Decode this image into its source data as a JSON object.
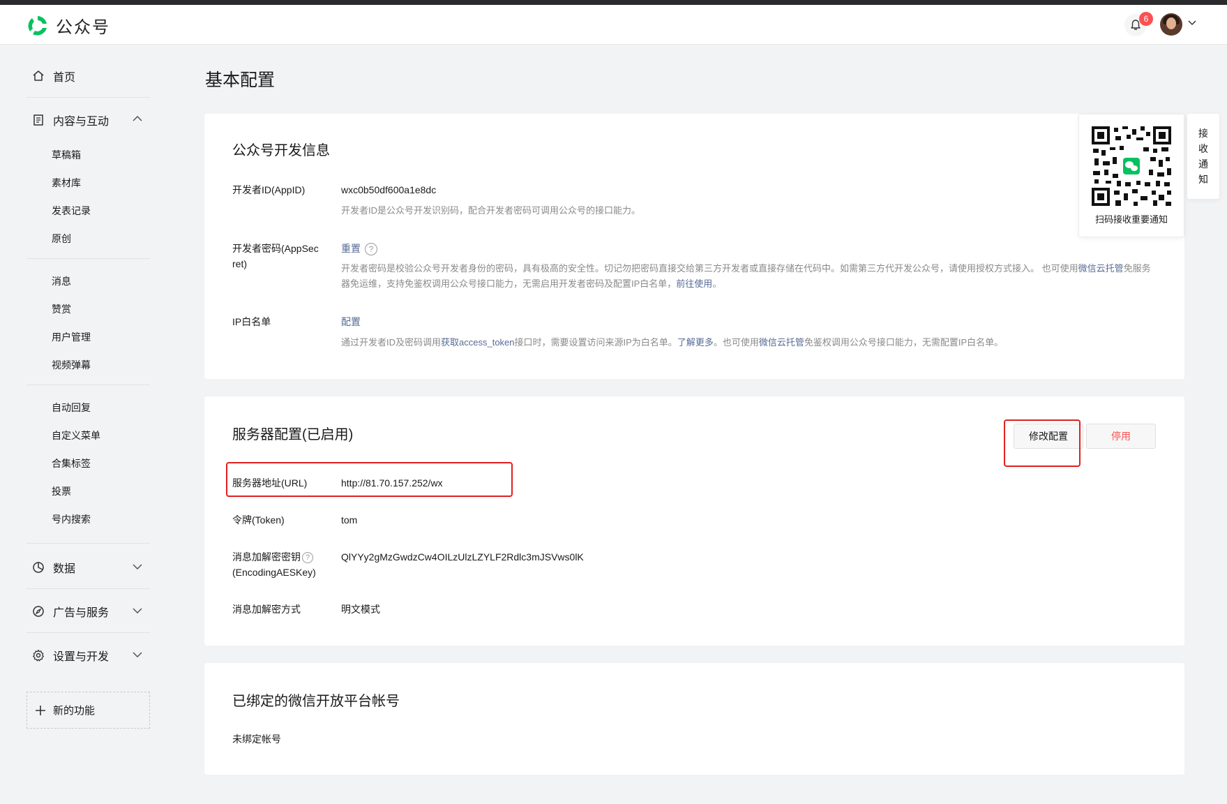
{
  "app": {
    "title": "公众号",
    "notifications_count": "6"
  },
  "sidebar": {
    "home": "首页",
    "content": {
      "label": "内容与互动",
      "group1": [
        "草稿箱",
        "素材库",
        "发表记录",
        "原创"
      ],
      "group2": [
        "消息",
        "赞赏",
        "用户管理",
        "视频弹幕"
      ],
      "group3": [
        "自动回复",
        "自定义菜单",
        "合集标签",
        "投票",
        "号内搜索"
      ]
    },
    "data": "数据",
    "ads": "广告与服务",
    "settings": "设置与开发",
    "new_feature": "新的功能"
  },
  "page": {
    "title": "基本配置"
  },
  "dev_info": {
    "title": "公众号开发信息",
    "appid_label": "开发者ID(AppID)",
    "appid_value": "wxc0b50df600a1e8dc",
    "appid_desc": "开发者ID是公众号开发识别码，配合开发者密码可调用公众号的接口能力。",
    "secret_label_line1": "开发者密码(AppSec",
    "secret_label_line2": "ret)",
    "secret_reset": "重置",
    "secret_desc1": "开发者密码是校验公众号开发者身份的密码，具有极高的安全性。切记勿把密码直接交给第三方开发者或直接存储在代码中。如需第三方代开发公众号，请使用授权方式接入。 也可使用",
    "secret_desc_link1a": "微信",
    "secret_desc_link1b": "云托管",
    "secret_desc2": "免服务器免运维，支持免鉴权调用公众号接口能力，无需启用开发者密码及配置IP白名单，",
    "secret_desc_link2": "前往使用",
    "secret_desc3": "。",
    "ip_label": "IP白名单",
    "ip_config": "配置",
    "ip_desc1": "通过开发者ID及密码调用",
    "ip_desc_link1": "获取access_token",
    "ip_desc2": "接口时，需要设置访问来源IP为白名单。",
    "ip_desc_link2": "了解更多",
    "ip_desc3": "。也可使用",
    "ip_desc_link3": "微信云托管",
    "ip_desc4": "免鉴权调用公众号接口能力，无需配置IP白名单。"
  },
  "server": {
    "title": "服务器配置(已启用)",
    "edit_button": "修改配置",
    "stop_button": "停用",
    "url_label": "服务器地址(URL)",
    "url_value": "http://81.70.157.252/wx",
    "token_label": "令牌(Token)",
    "token_value": "tom",
    "aes_label_line1": "消息加解密密钥",
    "aes_label_line2": "(EncodingAESKey)",
    "aes_value": "QlYYy2gMzGwdzCw4OILzUlzLZYLF2Rdlc3mJSVws0lK",
    "mode_label": "消息加解密方式",
    "mode_value": "明文模式"
  },
  "open_platform": {
    "title": "已绑定的微信开放平台帐号",
    "value": "未绑定帐号"
  },
  "qr": {
    "caption": "扫码接收重要通知"
  },
  "side_tab": [
    "接",
    "收",
    "通",
    "知"
  ],
  "colors": {
    "brand_green": "#07c160",
    "link": "#576b95",
    "danger": "#fa5151",
    "highlight_red": "#e02020"
  }
}
